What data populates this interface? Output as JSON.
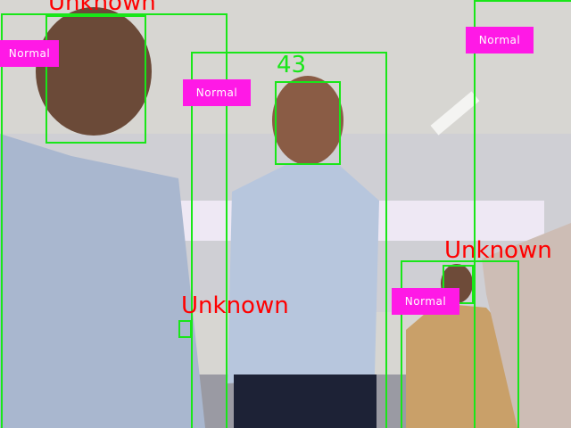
{
  "frame": {
    "description_free_status": "",
    "colors": {
      "box": "#19e619",
      "status_tag_bg": "#ff19e6",
      "status_tag_text": "#ffffff",
      "unknown_label": "#ff0000",
      "id_label": "#19e619"
    }
  },
  "detections": [
    {
      "status": "Normal",
      "identity": "Unknown"
    },
    {
      "status": "Normal",
      "identity": "43"
    },
    {
      "status": "Normal",
      "identity": "Unknown"
    },
    {
      "status": "Normal",
      "identity": "Unknown"
    },
    {
      "status": "Normal"
    }
  ]
}
